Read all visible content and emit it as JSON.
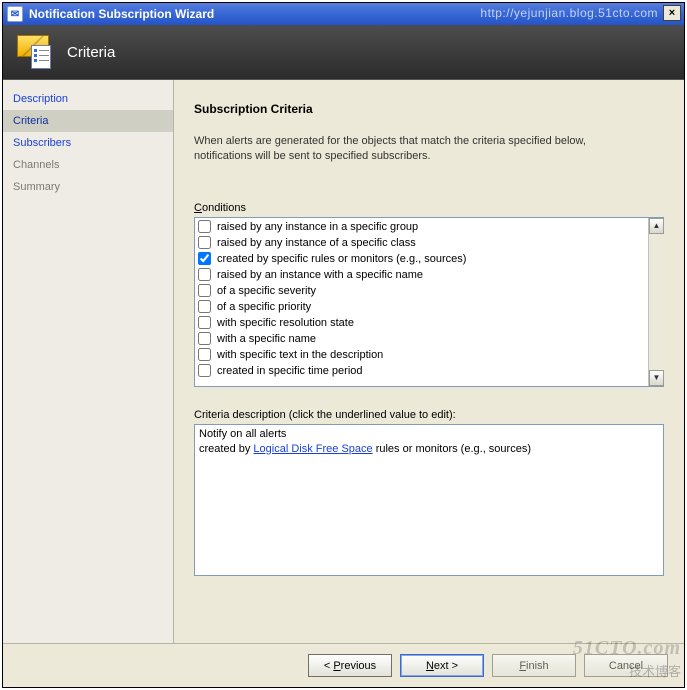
{
  "window": {
    "title": "Notification Subscription Wizard",
    "source_url_watermark": "http://yejunjian.blog.51cto.com",
    "close_label": "×"
  },
  "banner": {
    "title": "Criteria"
  },
  "sidebar": {
    "items": [
      {
        "label": "Description",
        "state": "link"
      },
      {
        "label": "Criteria",
        "state": "active"
      },
      {
        "label": "Subscribers",
        "state": "link"
      },
      {
        "label": "Channels",
        "state": "disabled"
      },
      {
        "label": "Summary",
        "state": "disabled"
      }
    ]
  },
  "main": {
    "heading": "Subscription Criteria",
    "intro": "When alerts are generated for the objects that match the criteria specified below, notifications will be sent to specified subscribers.",
    "conditions_label": "Conditions",
    "conditions": [
      {
        "checked": false,
        "label": "raised by any instance in a specific group"
      },
      {
        "checked": false,
        "label": "raised by any instance of a specific class"
      },
      {
        "checked": true,
        "label": "created by specific rules or monitors (e.g., sources)"
      },
      {
        "checked": false,
        "label": "raised by an instance with a specific name"
      },
      {
        "checked": false,
        "label": "of a specific severity"
      },
      {
        "checked": false,
        "label": "of a specific priority"
      },
      {
        "checked": false,
        "label": "with specific resolution state"
      },
      {
        "checked": false,
        "label": "with a specific name"
      },
      {
        "checked": false,
        "label": "with specific text in the description"
      },
      {
        "checked": false,
        "label": "created in specific time period"
      }
    ],
    "criteria_desc_label": "Criteria description (click the underlined value to edit):",
    "criteria_desc": {
      "line1": "Notify on all alerts",
      "line2_prefix": "created by ",
      "line2_link": "Logical Disk Free Space",
      "line2_suffix": " rules or monitors (e.g., sources)"
    }
  },
  "footer": {
    "previous": "Previous",
    "next": "Next",
    "finish": "Finish",
    "cancel": "Cancel"
  },
  "overlay": {
    "brand": "51CTO.com",
    "tag": "技术博客"
  }
}
